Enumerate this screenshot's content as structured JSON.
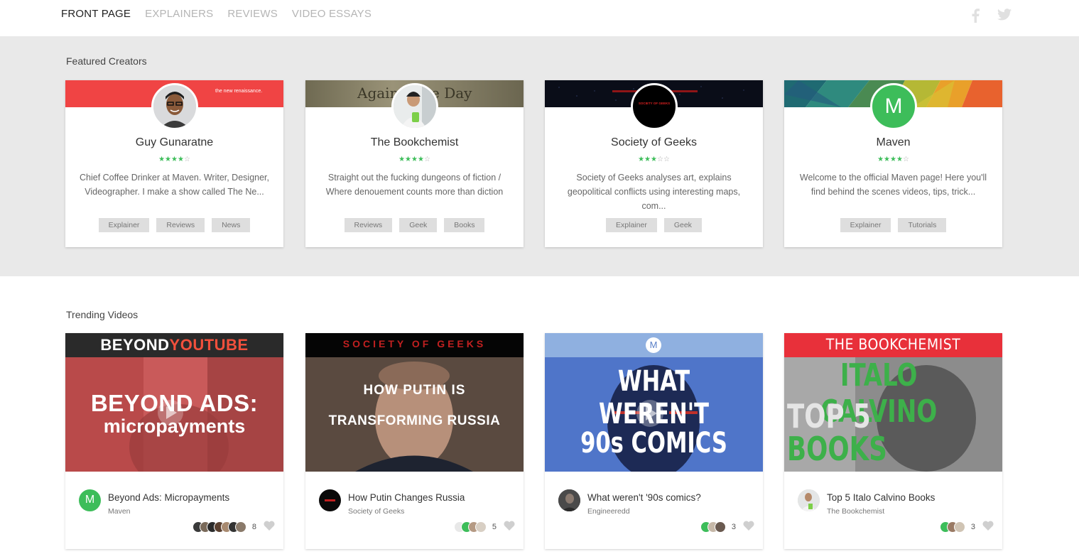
{
  "nav": {
    "links": [
      {
        "label": "FRONT PAGE",
        "active": true
      },
      {
        "label": "EXPLAINERS",
        "active": false
      },
      {
        "label": "REVIEWS",
        "active": false
      },
      {
        "label": "VIDEO ESSAYS",
        "active": false
      }
    ],
    "social": [
      "facebook-icon",
      "twitter-icon"
    ]
  },
  "featured": {
    "title": "Featured Creators",
    "creators": [
      {
        "name": "Guy Gunaratne",
        "rating": 4,
        "description": "Chief Coffee Drinker at Maven. Writer, Designer, Videographer. I make a show called The Ne...",
        "tags": [
          "Explainer",
          "Reviews",
          "News"
        ],
        "banner_text": "the new renaissance."
      },
      {
        "name": "The Bookchemist",
        "rating": 4,
        "description": "Straight out the fucking dungeons of fiction / Where denouement counts more than diction",
        "tags": [
          "Reviews",
          "Geek",
          "Books"
        ],
        "banner_text": "Against the Day"
      },
      {
        "name": "Society of Geeks",
        "rating": 3,
        "description": "Society of Geeks analyses art, explains geopolitical conflicts using interesting maps, com...",
        "tags": [
          "Explainer",
          "Geek"
        ],
        "avatar_text": "SOCIETY OF GEEKS"
      },
      {
        "name": "Maven",
        "rating": 4,
        "description": "Welcome to the official Maven page! Here you'll find behind the scenes videos, tips, trick...",
        "tags": [
          "Explainer",
          "Tutorials"
        ],
        "avatar_letter": "M"
      }
    ]
  },
  "trending": {
    "title": "Trending Videos",
    "videos": [
      {
        "title": "Beyond Ads: Micropayments",
        "channel": "Maven",
        "count": "8",
        "thumb_top_a": "BEYOND",
        "thumb_top_b": "YOUTUBE",
        "thumb_line1": "BEYOND ADS:",
        "thumb_line2": "micropayments",
        "avatar_letter": "M"
      },
      {
        "title": "How Putin Changes Russia",
        "channel": "Society of Geeks",
        "count": "5",
        "thumb_top": "SOCIETY OF GEEKS",
        "thumb_line1": "HOW PUTIN IS",
        "thumb_line2": "TRANSFORMING RUSSIA"
      },
      {
        "title": "What weren't '90s comics?",
        "channel": "Engineeredd",
        "count": "3",
        "thumb_badge": "M",
        "thumb_line1": "WHAT WEREN'T",
        "thumb_line2": "90s COMICS"
      },
      {
        "title": "Top 5 Italo Calvino Books",
        "channel": "The Bookchemist",
        "count": "3",
        "thumb_top": "THE BOOKCHEMIST",
        "thumb_line1": "ITALO CALVINO",
        "thumb_line2": "TOP 5",
        "thumb_line3": "BOOKS"
      }
    ]
  },
  "colors": {
    "accent_green": "#3dbd5a",
    "featured_bg": "#e9e9e9",
    "tag_bg": "#dedede"
  }
}
